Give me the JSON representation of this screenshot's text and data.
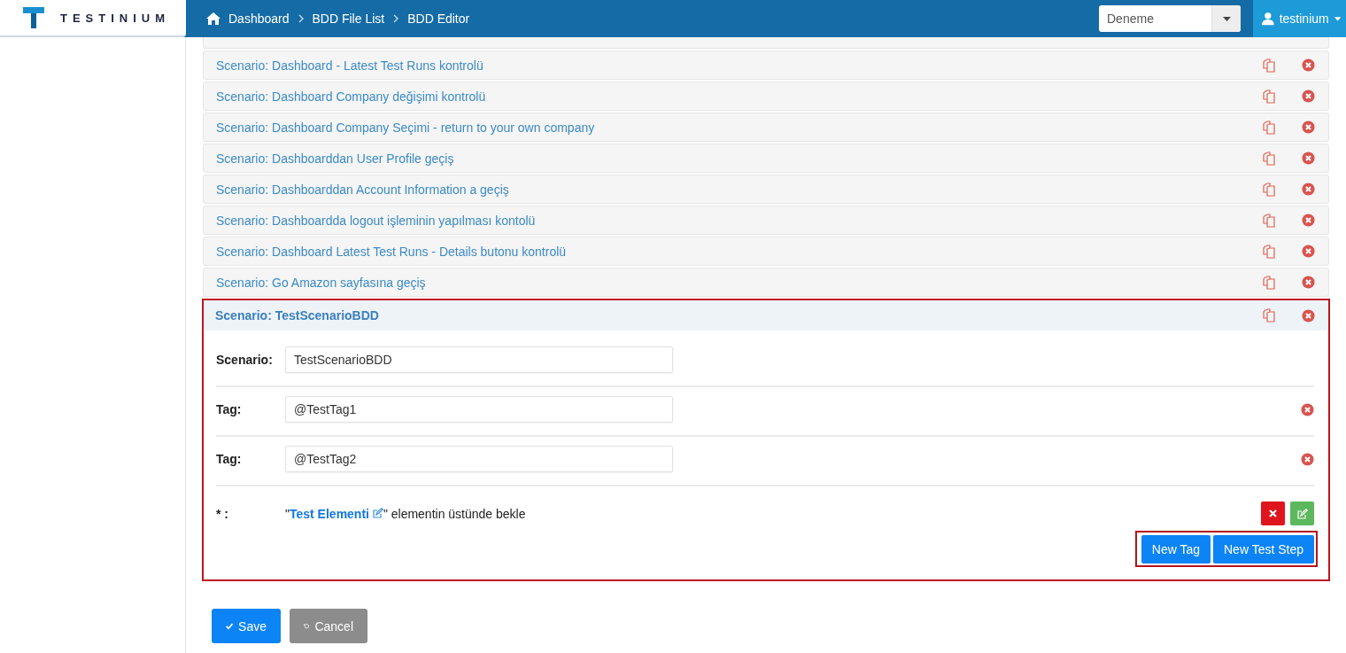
{
  "header": {
    "logo": "TESTINIUM",
    "breadcrumb": [
      "Dashboard",
      "BDD File List",
      "BDD Editor"
    ],
    "project_select": {
      "value": "Deneme"
    },
    "user_menu": "testinium"
  },
  "scenarios": [
    {
      "title": "Scenario: Dashboard - Latest Test Runs kontrolü",
      "expanded": false
    },
    {
      "title": "Scenario: Dashboard Company değişimi kontrolü",
      "expanded": false
    },
    {
      "title": "Scenario: Dashboard Company Seçimi - return to your own company",
      "expanded": false
    },
    {
      "title": "Scenario: Dashboarddan User Profile geçiş",
      "expanded": false
    },
    {
      "title": "Scenario: Dashboarddan Account Information a geçiş",
      "expanded": false
    },
    {
      "title": "Scenario: Dashboardda logout işleminin yapılması kontolü",
      "expanded": false
    },
    {
      "title": "Scenario: Dashboard Latest Test Runs - Details butonu kontrolü",
      "expanded": false
    },
    {
      "title": "Scenario: Go Amazon sayfasına geçiş",
      "expanded": false
    },
    {
      "title": "Scenario: TestScenarioBDD",
      "expanded": true
    }
  ],
  "editor": {
    "fields": [
      {
        "kind": "scenario",
        "label": "Scenario:",
        "value": "TestScenarioBDD"
      },
      {
        "kind": "tag",
        "label": "Tag:",
        "value": "@TestTag1"
      },
      {
        "kind": "tag",
        "label": "Tag:",
        "value": "@TestTag2"
      }
    ],
    "step": {
      "label": "* :",
      "open_quote": "\"",
      "element": "Test Elementi",
      "rest": "\" elementin üstünde bekle"
    },
    "buttons": [
      "New Tag",
      "New Test Step"
    ]
  },
  "actions": [
    "Save",
    "Cancel"
  ]
}
